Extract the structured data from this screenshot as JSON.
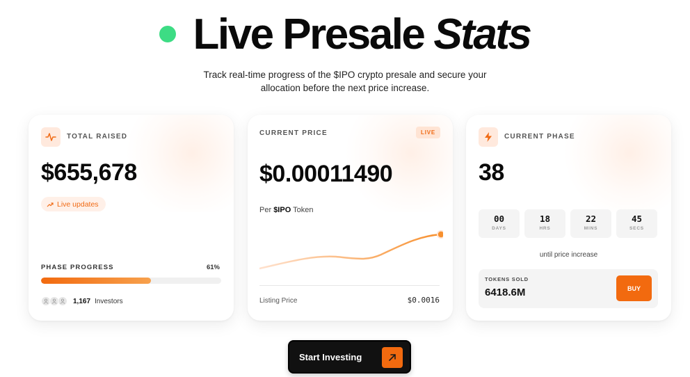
{
  "hero": {
    "title": "Live Presale",
    "title_italic": "Stats",
    "subtitle": "Track real-time progress of the $IPO crypto presale and secure your allocation before the next price increase."
  },
  "total_raised": {
    "label": "TOTAL RAISED",
    "icon": "activity-icon",
    "amount": "$655,678",
    "live_pill": "Live updates",
    "progress_label": "PHASE PROGRESS",
    "progress_pct": "61%",
    "progress_value": 0.61,
    "investors_count": "1,167",
    "investors_label": "Investors"
  },
  "current_price": {
    "label": "CURRENT PRICE",
    "badge": "LIVE",
    "price": "$0.00011490",
    "per_prefix": "Per",
    "per_token": "$IPO",
    "per_suffix": "Token",
    "listing_label": "Listing Price",
    "listing_value": "$0.0016"
  },
  "current_phase": {
    "label": "CURRENT PHASE",
    "icon": "lightning-icon",
    "phase": "38",
    "countdown": [
      {
        "value": "00",
        "unit": "DAYS"
      },
      {
        "value": "18",
        "unit": "HRS"
      },
      {
        "value": "22",
        "unit": "MINS"
      },
      {
        "value": "45",
        "unit": "SECS"
      }
    ],
    "until_text": "until price increase",
    "tokens_sold_label": "TOKENS SOLD",
    "tokens_sold_value": "6418.6M",
    "buy_label": "BUY"
  },
  "cta": {
    "label": "Start Investing",
    "icon": "arrow-up-right-icon"
  },
  "colors": {
    "accent": "#f26a0f",
    "live_dot": "#3ddc84"
  }
}
